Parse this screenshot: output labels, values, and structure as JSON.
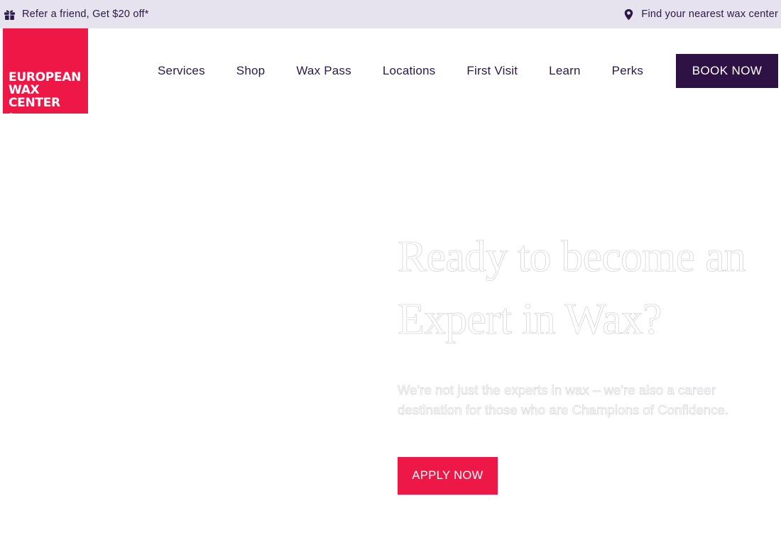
{
  "topbar": {
    "promo_text": "Refer a friend, Get $20 off*",
    "promo_icon": "gift-icon",
    "locator_text": "Find your nearest wax center",
    "locator_icon": "location-pin-icon",
    "background": "#e7e3ee",
    "text_color": "#2b1846"
  },
  "logo": {
    "line1": "EUROPEAN",
    "line2": "WAX",
    "line3": "CENTER",
    "registered": "®",
    "color": "#ee1847"
  },
  "nav": {
    "items": [
      {
        "label": "Services"
      },
      {
        "label": "Shop"
      },
      {
        "label": "Wax Pass"
      },
      {
        "label": "Locations"
      },
      {
        "label": "First Visit"
      },
      {
        "label": "Learn"
      },
      {
        "label": "Perks"
      }
    ],
    "book_label": "BOOK NOW",
    "book_color": "#2e1245"
  },
  "hero": {
    "title_line1": "Ready to become an",
    "title_line2": "Expert in Wax?",
    "body": "We're not just the experts in wax – we're also a career destination for those who are Champions of Confidence.",
    "apply_label": "APPLY NOW",
    "apply_color": "#ee1847"
  }
}
